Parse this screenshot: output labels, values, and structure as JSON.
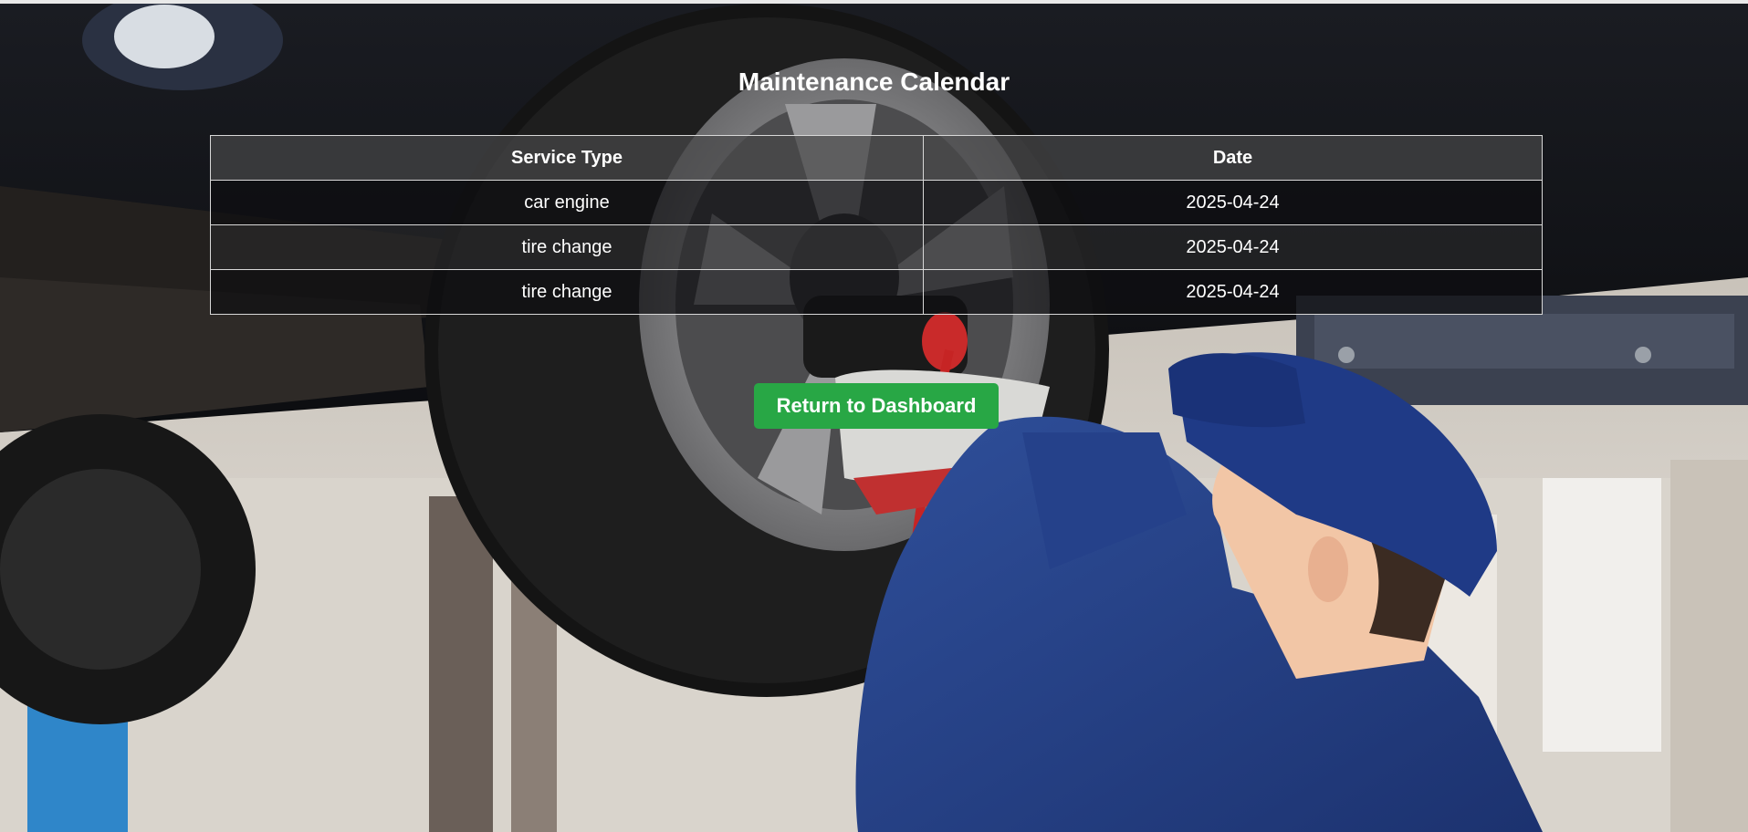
{
  "page": {
    "title": "Maintenance Calendar",
    "background_image": "mechanic-changing-tire-photo"
  },
  "table": {
    "headers": {
      "service_type": "Service Type",
      "date": "Date"
    },
    "rows": [
      {
        "service_type": "car engine",
        "date": "2025-04-24"
      },
      {
        "service_type": "tire change",
        "date": "2025-04-24"
      },
      {
        "service_type": "tire change",
        "date": "2025-04-24"
      }
    ]
  },
  "actions": {
    "return_label": "Return to Dashboard"
  },
  "colors": {
    "button": "#28a745",
    "text": "#ffffff",
    "table_border": "#d8d8d8"
  }
}
